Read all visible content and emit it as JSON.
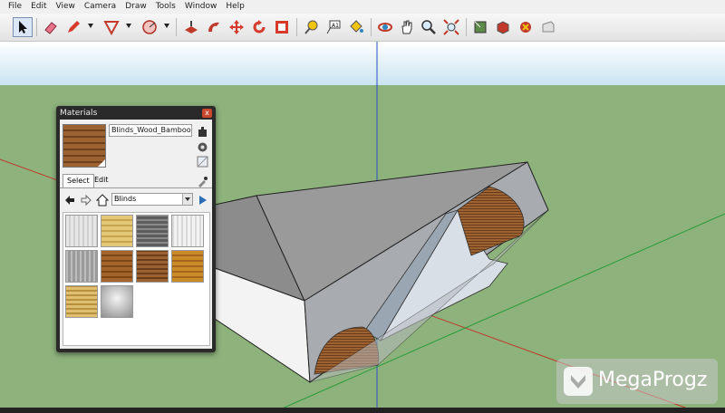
{
  "menu": {
    "items": [
      "File",
      "Edit",
      "View",
      "Camera",
      "Draw",
      "Tools",
      "Window",
      "Help"
    ]
  },
  "toolbar": {
    "tools": [
      "select-arrow-icon",
      "eraser-icon",
      "pencil-icon",
      "arc-icon",
      "circle-icon",
      "push-pull-icon",
      "follow-me-icon",
      "move-icon",
      "rotate-icon",
      "offset-icon",
      "tape-measure-icon",
      "text-icon",
      "paint-bucket-icon",
      "orbit-icon",
      "pan-icon",
      "zoom-icon",
      "zoom-extents-icon",
      "get-models-icon",
      "share-model-icon",
      "component-icon",
      "warehouse-icon"
    ]
  },
  "materials_panel": {
    "title": "Materials",
    "close": "x",
    "material_name": "Blinds_Wood_Bamboo",
    "tab_select": "Select",
    "tab_edit": "Edit",
    "library": "Blinds"
  },
  "watermark": {
    "text": "MegaProgz"
  },
  "colors": {
    "sky": "#cfe6f2",
    "ground": "#8fb27a",
    "accent": "#c9492e"
  }
}
